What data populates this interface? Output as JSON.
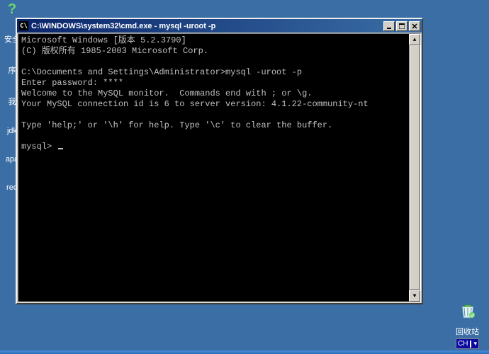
{
  "desktop": {
    "icons": [
      {
        "name": "help-icon",
        "label": "",
        "glyph": "?"
      },
      {
        "name": "folder-安全",
        "label": "安全",
        "glyph": ""
      },
      {
        "name": "folder-序",
        "label": "序",
        "glyph": ""
      },
      {
        "name": "folder-我",
        "label": "我",
        "glyph": ""
      },
      {
        "name": "folder-jdk",
        "label": "jdk",
        "glyph": ""
      },
      {
        "name": "folder-apa",
        "label": "apa",
        "glyph": ""
      },
      {
        "name": "folder-red",
        "label": "red",
        "glyph": ""
      }
    ],
    "recycle_bin_label": "回收站",
    "ime_label": "CH"
  },
  "window": {
    "title": "C:\\WINDOWS\\system32\\cmd.exe - mysql -uroot -p",
    "terminal_lines": [
      "Microsoft Windows [版本 5.2.3790]",
      "(C) 版权所有 1985-2003 Microsoft Corp.",
      "",
      "C:\\Documents and Settings\\Administrator>mysql -uroot -p",
      "Enter password: ****",
      "Welcome to the MySQL monitor.  Commands end with ; or \\g.",
      "Your MySQL connection id is 6 to server version: 4.1.22-community-nt",
      "",
      "Type 'help;' or '\\h' for help. Type '\\c' to clear the buffer.",
      "",
      "mysql> "
    ]
  }
}
